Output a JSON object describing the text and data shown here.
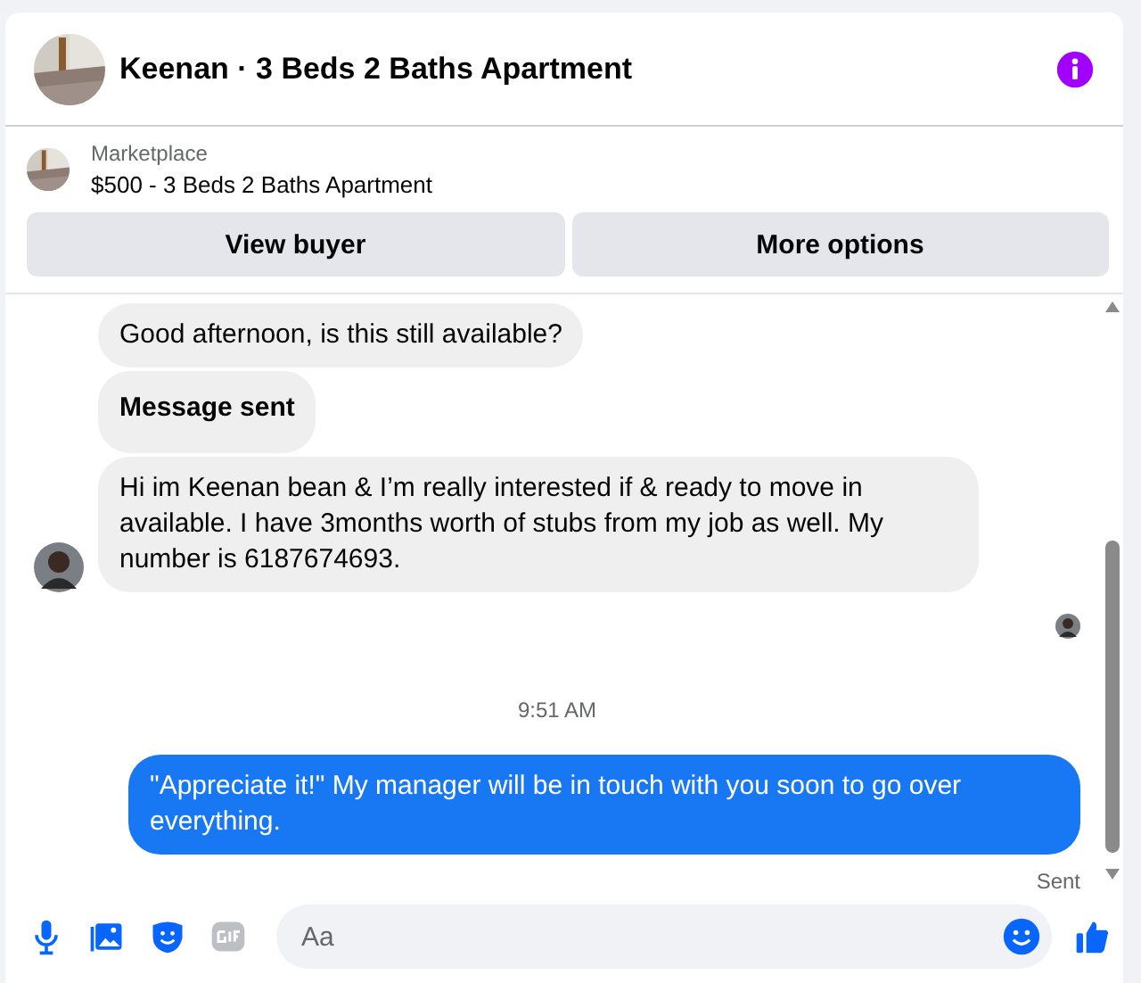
{
  "header": {
    "title": "Keenan · 3 Beds 2 Baths Apartment"
  },
  "listing": {
    "label": "Marketplace",
    "title": "$500 - 3 Beds 2 Baths Apartment"
  },
  "actions": [
    "View buyer",
    "More options"
  ],
  "messages": [
    {
      "kind": "incoming",
      "text": "Good afternoon, is this still available?",
      "bold": false,
      "avatar": false
    },
    {
      "kind": "incoming",
      "text": "Message sent",
      "bold": true,
      "avatar": false
    },
    {
      "kind": "incoming",
      "text": "Hi im Keenan bean & I’m really interested if & ready to move in available. I have 3months worth of stubs from my job as well. My number is 6187674693.",
      "bold": false,
      "avatar": true
    },
    {
      "kind": "seen"
    },
    {
      "kind": "time",
      "text": "9:51 AM"
    },
    {
      "kind": "outgoing",
      "text": "\"Appreciate it!\" My manager will be in touch with you soon to go over everything."
    },
    {
      "kind": "status",
      "text": "Sent"
    }
  ],
  "composer": {
    "placeholder": "Aa"
  }
}
